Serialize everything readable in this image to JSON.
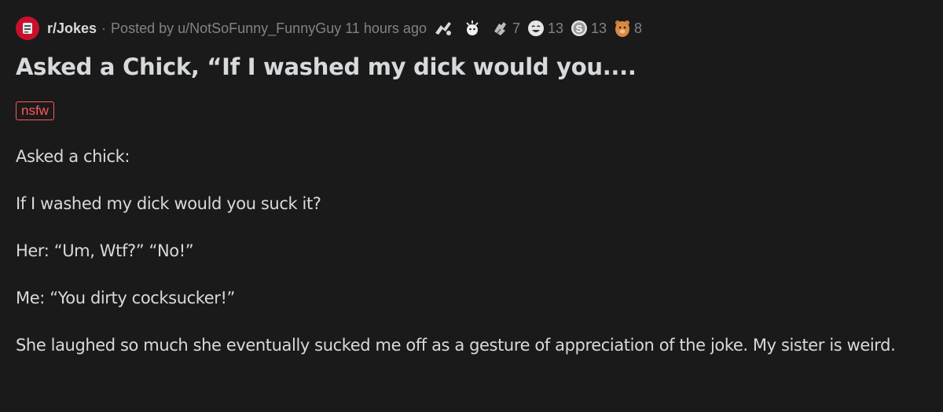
{
  "post": {
    "subreddit": "r/Jokes",
    "separator": "·",
    "posted_by": "Posted by u/NotSoFunny_FunnyGuy 11 hours ago",
    "awards": [
      {
        "icon": "rocket-like-award-icon",
        "count": ""
      },
      {
        "icon": "wholesome-award-icon",
        "count": ""
      },
      {
        "icon": "hand-award-icon",
        "count": "7"
      },
      {
        "icon": "laughing-face-award-icon",
        "count": "13"
      },
      {
        "icon": "silver-award-icon",
        "count": "13"
      },
      {
        "icon": "bear-award-icon",
        "count": "8"
      }
    ],
    "title": "Asked a Chick, “If I washed my dick would you....",
    "flair": "nsfw",
    "body": [
      "Asked a chick:",
      "If I washed my dick would you suck it?",
      "Her: “Um, Wtf?” “No!”",
      "Me: “You dirty cocksucker!”",
      "She laughed so much she eventually sucked me off as a gesture of appreciation of the joke. My sister is weird."
    ]
  },
  "colors": {
    "background": "#1a1a1b",
    "text": "#d7dadc",
    "muted": "#818384",
    "nsfw": "#ff585b",
    "subreddit_icon": "#c8102e"
  }
}
